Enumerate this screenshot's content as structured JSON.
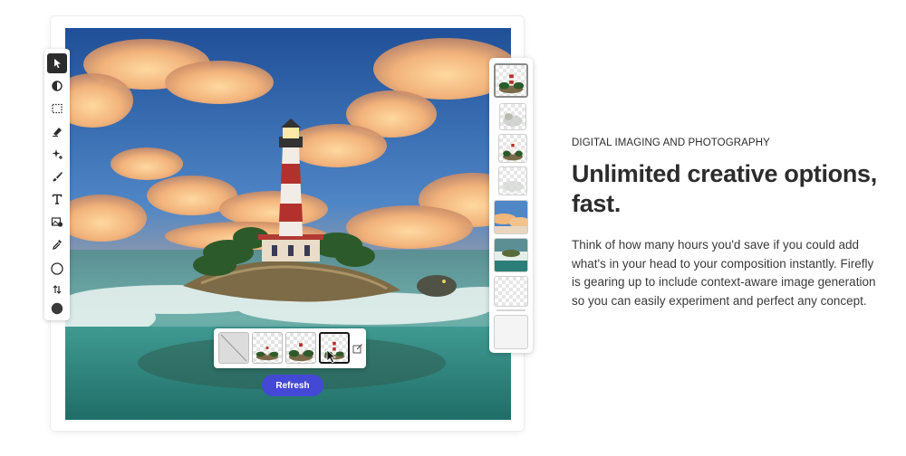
{
  "editor": {
    "tools": [
      {
        "icon": "select-arrow-icon",
        "active": true
      },
      {
        "icon": "contrast-adjust-icon",
        "active": false
      },
      {
        "icon": "marquee-select-icon",
        "active": false
      },
      {
        "icon": "eraser-icon",
        "active": false
      },
      {
        "icon": "generative-fill-sparkle-icon",
        "active": false
      },
      {
        "icon": "brush-icon",
        "active": false
      },
      {
        "icon": "text-tool-icon",
        "active": false
      },
      {
        "icon": "image-settings-icon",
        "active": false
      },
      {
        "icon": "eyedropper-icon",
        "active": false
      },
      {
        "icon": "ellipse-shape-icon",
        "active": false
      },
      {
        "icon": "swap-colors-icon",
        "active": false
      },
      {
        "icon": "color-swatch-icon",
        "active": false
      }
    ],
    "variations": [
      {
        "kind": "lighthouse-island",
        "selected": true
      },
      {
        "kind": "faded-island",
        "selected": false
      },
      {
        "kind": "lighthouse-island-small",
        "selected": false
      },
      {
        "kind": "faded-island-light",
        "selected": false
      },
      {
        "kind": "sunset-sky",
        "selected": false
      },
      {
        "kind": "ocean-scene",
        "selected": false
      },
      {
        "kind": "empty",
        "selected": false
      },
      {
        "kind": "blank",
        "selected": false
      }
    ],
    "generated_options": [
      {
        "kind": "none",
        "selected": false
      },
      {
        "kind": "island-small",
        "selected": false
      },
      {
        "kind": "island-medium",
        "selected": false
      },
      {
        "kind": "island-lighthouse",
        "selected": true
      }
    ],
    "refresh_label": "Refresh",
    "colors": {
      "accent": "#4349d4",
      "tool_active": "#2c2c2c"
    }
  },
  "content": {
    "eyebrow": "DIGITAL IMAGING AND PHOTOGRAPHY",
    "headline_line1": "Unlimited creative options,",
    "headline_line2": "fast.",
    "body": "Think of how many hours you'd save if you could add what's in your head to your composition instantly. Firefly is gearing up to include context-aware image generation so you can easily experiment and perfect any concept."
  }
}
